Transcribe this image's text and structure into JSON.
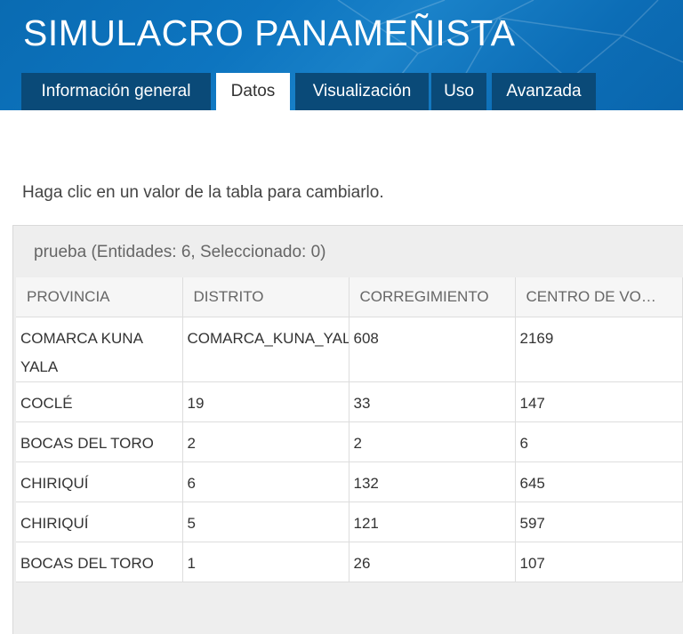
{
  "app": {
    "title": "SIMULACRO PANAMEÑISTA"
  },
  "tabs": [
    {
      "label": "Información general",
      "active": false
    },
    {
      "label": "Datos",
      "active": true
    },
    {
      "label": "Visualización",
      "active": false
    },
    {
      "label": "Uso",
      "active": false
    },
    {
      "label": "Avanzada",
      "active": false
    }
  ],
  "instructions": "Haga clic en un valor de la tabla para cambiarlo.",
  "table": {
    "caption": "prueba (Entidades: 6, Seleccionado: 0)",
    "columns": [
      "PROVINCIA",
      "DISTRITO",
      "CORREGIMIENTO",
      "CENTRO DE VO…"
    ],
    "rows": [
      [
        "COMARCA KUNA YALA",
        "COMARCA_KUNA_YALA",
        "608",
        "2169"
      ],
      [
        "COCLÉ",
        "19",
        "33",
        "147"
      ],
      [
        "BOCAS DEL TORO",
        "2",
        "2",
        "6"
      ],
      [
        "CHIRIQUÍ",
        "6",
        "132",
        "645"
      ],
      [
        "CHIRIQUÍ",
        "5",
        "121",
        "597"
      ],
      [
        "BOCAS DEL TORO",
        "1",
        "26",
        "107"
      ]
    ]
  },
  "colors": {
    "header_blue": "#0d75c0",
    "tab_dark": "#0a4a78"
  }
}
